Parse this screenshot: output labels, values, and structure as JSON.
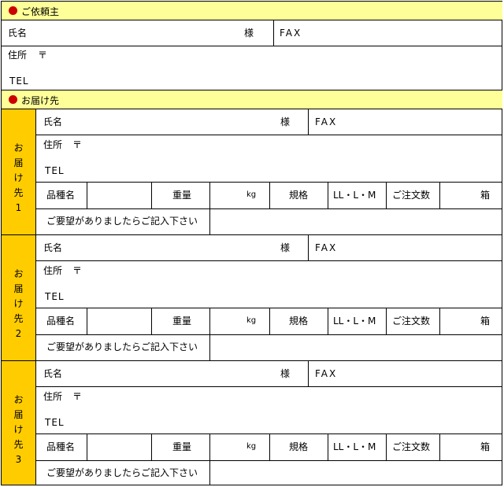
{
  "requester": {
    "heading": "ご依頼主",
    "name_label": "氏名",
    "honorific": "様",
    "fax_label": "FAX",
    "address_label": "住所",
    "postal_mark": "〒",
    "tel_label": "TEL"
  },
  "destination_heading": "お届け先",
  "deliveries": [
    {
      "side_chars": [
        "お",
        "届",
        "け",
        "先",
        "1"
      ],
      "name_label": "氏名",
      "honorific": "様",
      "fax_label": "FAX",
      "address_label": "住所",
      "postal_mark": "〒",
      "tel_label": "TEL",
      "product_label": "品種名",
      "weight_label": "重量",
      "weight_unit": "kg",
      "spec_label": "規格",
      "size_options": "LL・L・M",
      "quantity_label": "ご注文数",
      "box_unit": "箱",
      "request_label": "ご要望がありましたらご記入下さい"
    },
    {
      "side_chars": [
        "お",
        "届",
        "け",
        "先",
        "2"
      ],
      "name_label": "氏名",
      "honorific": "様",
      "fax_label": "FAX",
      "address_label": "住所",
      "postal_mark": "〒",
      "tel_label": "TEL",
      "product_label": "品種名",
      "weight_label": "重量",
      "weight_unit": "kg",
      "spec_label": "規格",
      "size_options": "LL・L・M",
      "quantity_label": "ご注文数",
      "box_unit": "箱",
      "request_label": "ご要望がありましたらご記入下さい"
    },
    {
      "side_chars": [
        "お",
        "届",
        "け",
        "先",
        "3"
      ],
      "name_label": "氏名",
      "honorific": "様",
      "fax_label": "FAX",
      "address_label": "住所",
      "postal_mark": "〒",
      "tel_label": "TEL",
      "product_label": "品種名",
      "weight_label": "重量",
      "weight_unit": "kg",
      "spec_label": "規格",
      "size_options": "LL・L・M",
      "quantity_label": "ご注文数",
      "box_unit": "箱",
      "request_label": "ご要望がありましたらご記入下さい"
    }
  ],
  "colors": {
    "header_fill": "#ffff99",
    "side_fill": "#ffcc00",
    "bullet": "#cc0000"
  }
}
